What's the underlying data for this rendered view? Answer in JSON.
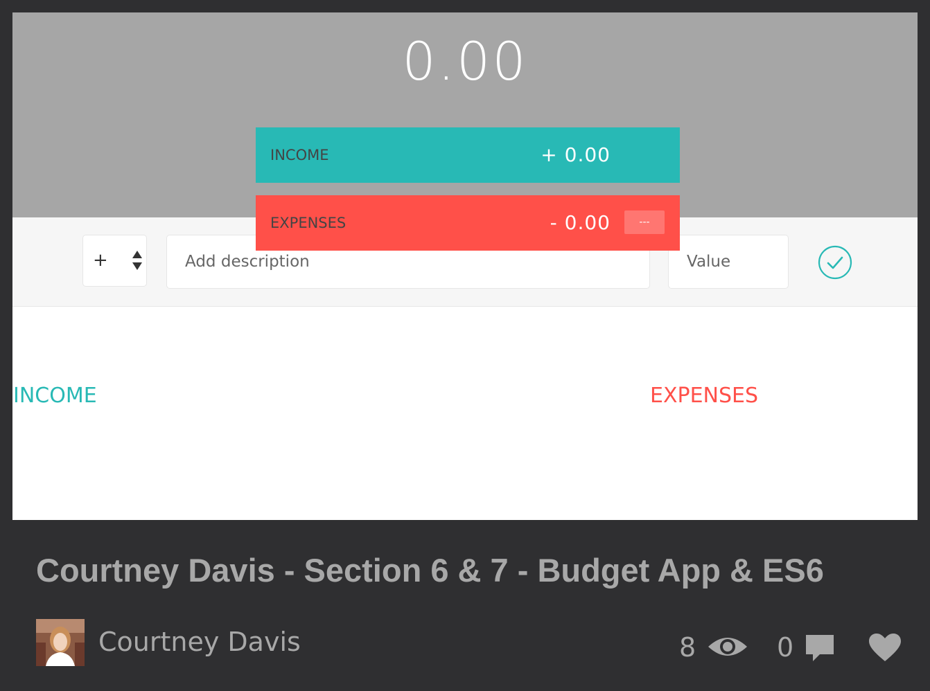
{
  "budget": {
    "total": "0.00",
    "income": {
      "label": "INCOME",
      "value": "+ 0.00"
    },
    "expenses": {
      "label": "EXPENSES",
      "value": "- 0.00",
      "percentage": "---"
    }
  },
  "add_form": {
    "type_value": "+",
    "description_placeholder": "Add description",
    "value_placeholder": "Value"
  },
  "lists": {
    "income_title": "INCOME",
    "expenses_title": "EXPENSES"
  },
  "footer": {
    "title": "Courtney Davis - Section 6 & 7 - Budget App & ES6",
    "author": "Courtney Davis",
    "views": "8",
    "comments": "0"
  },
  "colors": {
    "income": "#28b9b5",
    "expenses": "#ff5049",
    "header_bg": "#a6a6a6",
    "frame_bg": "#2f2f31"
  },
  "icons": {
    "type_arrows": "up-down-arrows-icon",
    "add": "check-circle-icon",
    "views": "eye-icon",
    "comments": "comment-bubble-icon",
    "like": "heart-icon"
  }
}
